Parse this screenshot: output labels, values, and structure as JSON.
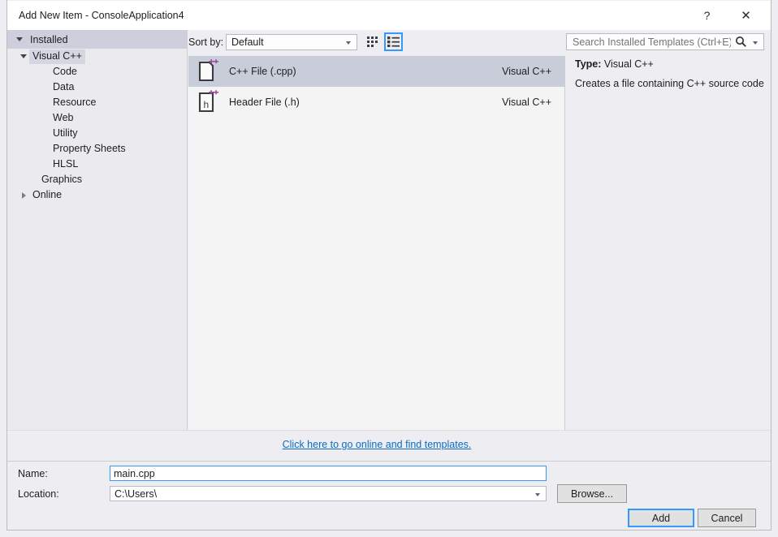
{
  "window": {
    "title": "Add New Item - ConsoleApplication4",
    "help_glyph": "?",
    "close_glyph": "✕"
  },
  "sidebar": {
    "header_label": "Installed",
    "tree": [
      {
        "label": "Visual C++",
        "level": 0,
        "expander": "down",
        "selected": true
      },
      {
        "label": "Code",
        "level": 1,
        "expander": "none",
        "selected": false
      },
      {
        "label": "Data",
        "level": 1,
        "expander": "none",
        "selected": false
      },
      {
        "label": "Resource",
        "level": 1,
        "expander": "none",
        "selected": false
      },
      {
        "label": "Web",
        "level": 1,
        "expander": "none",
        "selected": false
      },
      {
        "label": "Utility",
        "level": 1,
        "expander": "none",
        "selected": false
      },
      {
        "label": "Property Sheets",
        "level": 1,
        "expander": "none",
        "selected": false
      },
      {
        "label": "HLSL",
        "level": 1,
        "expander": "none",
        "selected": false
      },
      {
        "label": "Graphics",
        "level": 2,
        "expander": "none",
        "selected": false
      },
      {
        "label": "Online",
        "level": 0,
        "expander": "right",
        "selected": false
      }
    ]
  },
  "toolbar": {
    "sort_label": "Sort by:",
    "sort_value": "Default",
    "view_grid_name": "medium-icons-view",
    "view_list_name": "list-view",
    "view_list_selected": true
  },
  "templates": {
    "items": [
      {
        "name": "C++ File (.cpp)",
        "origin": "Visual C++",
        "icon": "cpp-file-icon",
        "glyph": "",
        "selected": true
      },
      {
        "name": "Header File (.h)",
        "origin": "Visual C++",
        "icon": "header-file-icon",
        "glyph": "h",
        "selected": false
      }
    ],
    "online_link": "Click here to go online and find templates."
  },
  "search": {
    "placeholder": "Search Installed Templates (Ctrl+E)"
  },
  "details": {
    "type_label": "Type:",
    "type_value": "Visual C++",
    "description": "Creates a file containing C++ source code"
  },
  "fields": {
    "name_label": "Name:",
    "name_value": "main.cpp",
    "location_label": "Location:",
    "location_value": "C:\\Users\\"
  },
  "buttons": {
    "browse": "Browse...",
    "add": "Add",
    "cancel": "Cancel"
  },
  "colors": {
    "dialog_bg": "#eeeef2",
    "sidebar_bg": "#ebebee",
    "installed_header_bg": "#cdcfdd",
    "list_bg": "#f5f4f4",
    "selection_bg": "#c9cdda",
    "accent_blue": "#3399ff",
    "link_blue": "#0a6bc4",
    "icon_purple": "#9b4f9b"
  }
}
